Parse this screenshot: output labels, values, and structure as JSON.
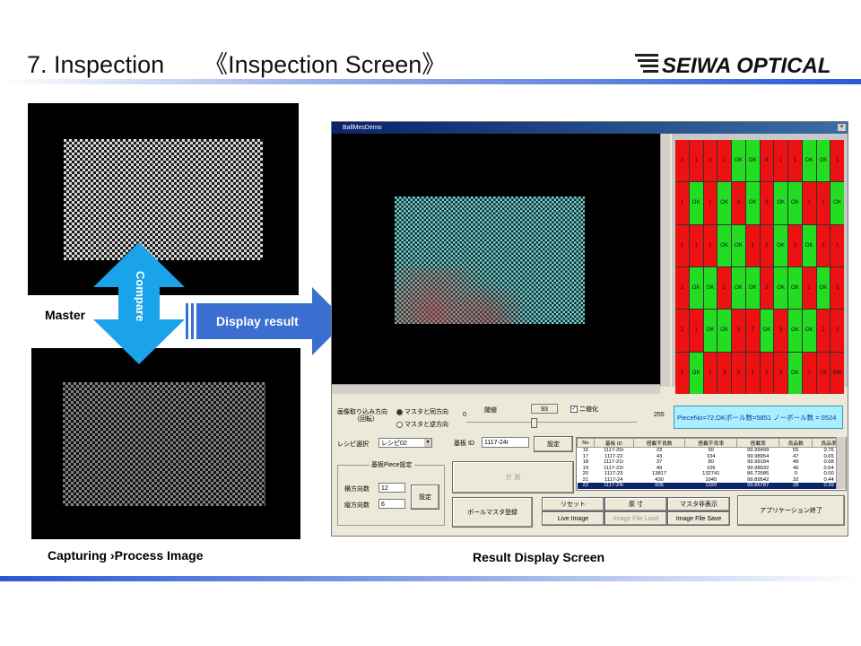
{
  "slide": {
    "title": "7. Inspection",
    "subtitle": "《Inspection Screen》",
    "logo_text": "SEIWA OPTICAL",
    "master_label": "Master",
    "capture_label": "Capturing  ›Process Image",
    "result_label": "Result Display  Screen",
    "compare_label": "Compare",
    "display_result_label": "Display result",
    "colors": {
      "accent_blue": "#2a58d6",
      "arrow_cyan": "#1aa3e8",
      "arrow_blue": "#3a6fd0",
      "ok_green": "#22dd22",
      "ng_red": "#ee1111"
    }
  },
  "window": {
    "title": "BallMesDemo",
    "close": "×",
    "grid": {
      "rows": [
        [
          "3",
          "1",
          "3",
          "1",
          "OK",
          "OK",
          "4",
          "1",
          "1",
          "OK",
          "OK",
          "1"
        ],
        [
          "1",
          "OK",
          "1",
          "OK",
          "3",
          "OK",
          "3",
          "OK",
          "OK",
          "1",
          "1",
          "OK"
        ],
        [
          "1",
          "1",
          "1",
          "OK",
          "OK",
          "1",
          "2",
          "OK",
          "3",
          "OK",
          "3",
          "1"
        ],
        [
          "1",
          "OK",
          "OK",
          "1",
          "OK",
          "OK",
          "3",
          "OK",
          "OK",
          "1",
          "OK",
          "3"
        ],
        [
          "2",
          "1",
          "OK",
          "OK",
          "3",
          "7",
          "OK",
          "3",
          "OK",
          "OK",
          "2",
          "3"
        ],
        [
          "3",
          "OK",
          "1",
          "3",
          "2",
          "1",
          "2",
          "3",
          "OK",
          "7",
          "13",
          "536"
        ]
      ]
    },
    "controls": {
      "capture_direction_label": "画像取り込み方向\n（回転）",
      "radio_same": "マスタと同方向",
      "radio_reverse": "マスタと逆方向",
      "threshold_label": "閾値",
      "threshold_value": "93",
      "binarize_label": "二値化",
      "slider_min": "0",
      "slider_max": "255",
      "slider_value": 0.38,
      "piece_info": "PieceNo=72,OKボール数=5851 ノーボール数 = 0524",
      "recipe_label": "レシピ選択",
      "recipe_value": "レシピ02",
      "board_id_label": "基板 ID",
      "board_id_value": "1117-24r",
      "set_button": "設定",
      "piece_group_label": "基板Piece設定",
      "horizontal_label": "横方向数",
      "horizontal_value": "12",
      "vertical_label": "縦方向数",
      "vertical_value": "6",
      "piece_set_button": "設定",
      "measure_button": "計 測",
      "ball_master_button": "ボールマスタ登録",
      "reset_button": "リセット",
      "original_size_button": "原 寸",
      "master_hide_button": "マスタ非表示",
      "live_image_button": "Live Image",
      "image_file_load_button": "Image File Load",
      "image_file_save_button": "Image File Save",
      "exit_button": "アプリケーション終了"
    },
    "table": {
      "headers": [
        "No",
        "基板 ID",
        "搭載不良数",
        "搭載不良率",
        "搭載率",
        "良品数",
        "良品率"
      ],
      "rows": [
        [
          "16",
          "1117-20r",
          "23",
          "50",
          "99.99499",
          "55",
          "0.76"
        ],
        [
          "17",
          "1117-22",
          "43",
          "104",
          "99.98954",
          "47",
          "0.65"
        ],
        [
          "18",
          "1117-21r",
          "37",
          "80",
          "99.99184",
          "49",
          "0.68"
        ],
        [
          "19",
          "1117-22r",
          "49",
          "106",
          "99.98932",
          "46",
          "0.64"
        ],
        [
          "20",
          "1117-23",
          "13817",
          "132741",
          "86.72585",
          "0",
          "0.00"
        ],
        [
          "21",
          "1117-24",
          "430",
          "1045",
          "99.89542",
          "32",
          "0.44"
        ],
        [
          "22",
          "1117-24r",
          "606",
          "1320",
          "99.86787",
          "28",
          "0.39"
        ]
      ],
      "selected_row": 6
    }
  }
}
